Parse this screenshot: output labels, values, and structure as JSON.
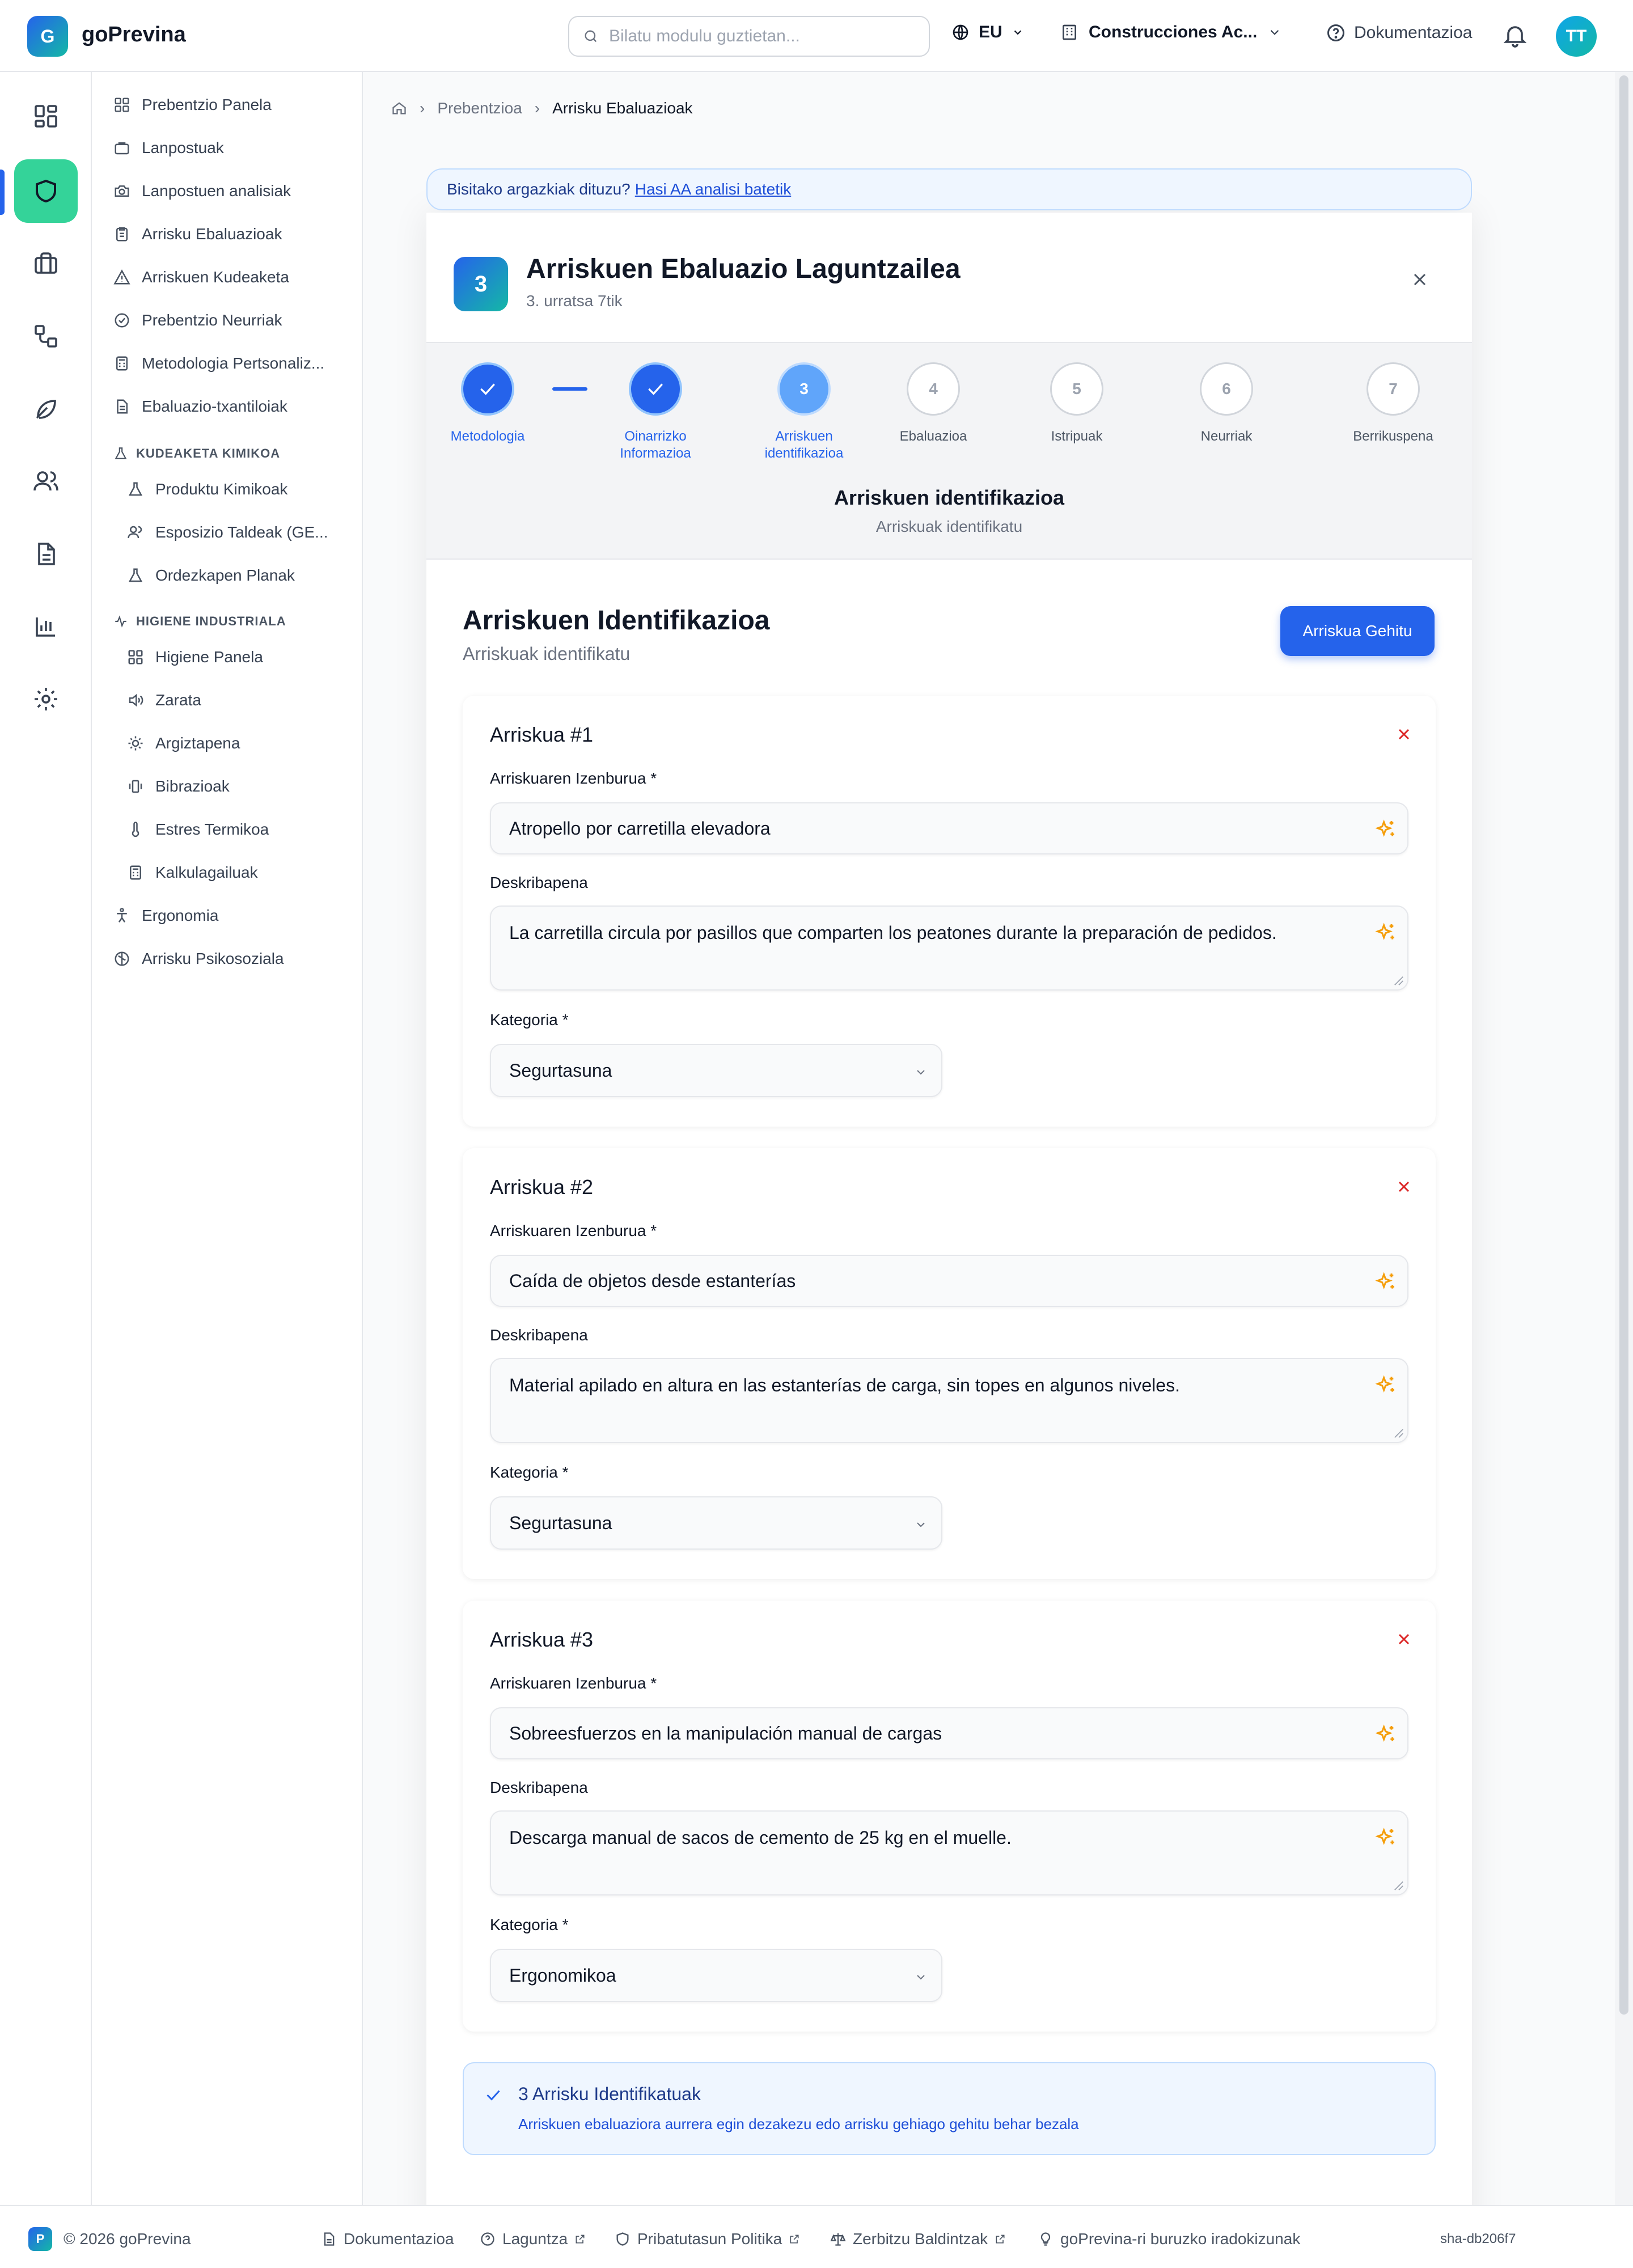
{
  "app": {
    "logo_letter": "G",
    "name": "goPrevina"
  },
  "header": {
    "search_placeholder": "Bilatu modulu guztietan...",
    "language": "EU",
    "company": "Construcciones Ac...",
    "docs": "Dokumentazioa",
    "user_initials": "TT"
  },
  "rail": {
    "icons": [
      "dashboard-icon",
      "shield-icon",
      "briefcase-icon",
      "workflow-icon",
      "leaf-icon",
      "users-icon",
      "document-icon",
      "bar-chart-icon",
      "gear-icon"
    ],
    "active_index": 1
  },
  "sidebar": {
    "items": [
      {
        "label": "Prebentzio Panela",
        "icon": "dashboard-icon"
      },
      {
        "label": "Lanpostuak",
        "icon": "briefcase-icon"
      },
      {
        "label": "Lanpostuen analisiak",
        "icon": "camera-icon"
      },
      {
        "label": "Arrisku Ebaluazioak",
        "icon": "clipboard-icon"
      },
      {
        "label": "Arriskuen Kudeaketa",
        "icon": "warning-icon"
      },
      {
        "label": "Prebentzio Neurriak",
        "icon": "check-circle-icon"
      },
      {
        "label": "Metodologia Pertsonaliz...",
        "icon": "calculator-icon"
      },
      {
        "label": "Ebaluazio-txantiloiak",
        "icon": "file-icon"
      }
    ],
    "chem_section": "KUDEAKETA KIMIKOA",
    "chem_items": [
      {
        "label": "Produktu Kimikoak",
        "icon": "flask-icon"
      },
      {
        "label": "Esposizio Taldeak (GE...",
        "icon": "users-icon"
      },
      {
        "label": "Ordezkapen Planak",
        "icon": "flask-icon"
      }
    ],
    "hyg_section": "HIGIENE INDUSTRIALA",
    "hyg_items": [
      {
        "label": "Higiene Panela",
        "icon": "dashboard-icon"
      },
      {
        "label": "Zarata",
        "icon": "speaker-icon"
      },
      {
        "label": "Argiztapena",
        "icon": "sun-icon"
      },
      {
        "label": "Bibrazioak",
        "icon": "vibration-icon"
      },
      {
        "label": "Estres Termikoa",
        "icon": "thermometer-icon"
      },
      {
        "label": "Kalkulagailuak",
        "icon": "calculator-icon"
      }
    ],
    "tail_items": [
      {
        "label": "Ergonomia",
        "icon": "person-icon"
      },
      {
        "label": "Arrisku Psikosoziala",
        "icon": "brain-icon"
      }
    ]
  },
  "breadcrumb": {
    "home_icon": "home-icon",
    "parent": "Prebentzioa",
    "current": "Arrisku Ebaluazioak"
  },
  "banner": {
    "text": "Bisitako argazkiak dituzu?",
    "link": "Hasi AA analisi batetik"
  },
  "modal": {
    "step_number": "3",
    "title": "Arriskuen Ebaluazio Laguntzailea",
    "subtitle": "3. urratsa 7tik",
    "steps": [
      {
        "num": "1",
        "label": "Metodologia",
        "state": "done"
      },
      {
        "num": "2",
        "label": "Oinarrizko Informazioa",
        "state": "done"
      },
      {
        "num": "3",
        "label": "Arriskuen identifikazioa",
        "state": "current"
      },
      {
        "num": "4",
        "label": "Ebaluazioa",
        "state": "todo"
      },
      {
        "num": "5",
        "label": "Istripuak",
        "state": "todo"
      },
      {
        "num": "6",
        "label": "Neurriak",
        "state": "todo"
      },
      {
        "num": "7",
        "label": "Berrikuspena",
        "state": "todo"
      }
    ],
    "phase_title": "Arriskuen identifikazioa",
    "phase_subtitle": "Arriskuak identifikatu"
  },
  "section": {
    "title": "Arriskuen Identifikazioa",
    "subtitle": "Arriskuak identifikatu",
    "add_button": "Arriskua Gehitu"
  },
  "labels": {
    "name": "Arriskuaren Izenburua *",
    "description": "Deskribapena",
    "category": "Kategoria *"
  },
  "risks": [
    {
      "title": "Arriskua #1",
      "name": "Atropello por carretilla elevadora",
      "description": "La carretilla circula por pasillos que comparten los peatones durante la preparación de pedidos.",
      "category": "Segurtasuna"
    },
    {
      "title": "Arriskua #2",
      "name": "Caída de objetos desde estanterías",
      "description": "Material apilado en altura en las estanterías de carga, sin topes en algunos niveles.",
      "category": "Segurtasuna"
    },
    {
      "title": "Arriskua #3",
      "name": "Sobreesfuerzos en la manipulación manual de cargas",
      "description": "Descarga manual de sacos de cemento de 25 kg en el muelle.",
      "category": "Ergonomikoa"
    }
  ],
  "summary": {
    "title": "3 Arrisku Identifikatuak",
    "text": "Arriskuen ebaluaziora aurrera egin dezakezu edo arrisku gehiago gehitu behar bezala"
  },
  "footer": {
    "badge": "P",
    "copyright": "© 2026 goPrevina",
    "links": [
      {
        "label": "Dokumentazioa",
        "icon": "document-icon"
      },
      {
        "label": "Laguntza",
        "icon": "help-icon"
      },
      {
        "label": "Pribatutasun Politika",
        "icon": "shield-icon"
      },
      {
        "label": "Zerbitzu Baldintzak",
        "icon": "scale-icon"
      },
      {
        "label": "goPrevina-ri buruzko iradokizunak",
        "icon": "lightbulb-icon"
      }
    ],
    "sha": "sha-db206f7"
  },
  "colors": {
    "primary": "#2563eb",
    "accent": "#34d399",
    "danger": "#dc2626",
    "spark": "#f59e0b"
  }
}
